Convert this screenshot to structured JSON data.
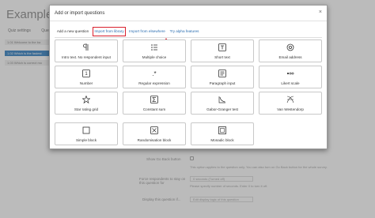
{
  "background": {
    "title": "Example ex",
    "tabs": [
      "Quiz settings",
      "Quest"
    ],
    "list_items": [
      "1.01 Welcome to the ba",
      "1.02 Which is the fastest",
      "1.03 Which is correct mo"
    ],
    "rows": [
      {
        "label": "Show Go Back button",
        "note": "This option applies to the question only. You can also turn on Go Back button for the whole survey."
      },
      {
        "label": "Force respondents to stay on this question for",
        "field": "0 seconds (Turned off)",
        "note": "Please specify number of seconds. Enter 0 to turn it off."
      },
      {
        "label": "Display this question if...",
        "field": "Edit display logic of this question"
      }
    ]
  },
  "modal": {
    "title": "Add or import questions",
    "close": "×",
    "tabs": [
      {
        "label": "Add a new question"
      },
      {
        "label": "Import from library"
      },
      {
        "label": "Import from elsewhere"
      },
      {
        "label": "Try alpha features"
      }
    ],
    "tiles": [
      {
        "label": "Intro text. No respondent input",
        "icon": "paragraph-icon"
      },
      {
        "label": "Multiple choice",
        "icon": "list-icon"
      },
      {
        "label": "Short text",
        "icon": "text-cursor-icon"
      },
      {
        "label": "Email address",
        "icon": "email-icon"
      },
      {
        "label": "Number",
        "icon": "number-icon"
      },
      {
        "label": "Regular expression",
        "icon": "regex-icon"
      },
      {
        "label": "Paragraph input",
        "icon": "paragraph-input-icon"
      },
      {
        "label": "Likert scale",
        "icon": "likert-icon"
      },
      {
        "label": "Star rating grid",
        "icon": "star-icon"
      },
      {
        "label": "Constant sum",
        "icon": "sigma-icon"
      },
      {
        "label": "Gabor-Granger test",
        "icon": "curve-chart-icon"
      },
      {
        "label": "Van Westendorp",
        "icon": "cross-lines-chart-icon"
      },
      {
        "label": "Simple block",
        "icon": "block-icon"
      },
      {
        "label": "Randomisation block",
        "icon": "shuffle-block-icon"
      },
      {
        "label": "Monadic block",
        "icon": "monadic-block-icon"
      }
    ]
  },
  "colors": {
    "highlight": "#d9202d",
    "link": "#2a6db0",
    "active_list": "#3e87c6"
  }
}
